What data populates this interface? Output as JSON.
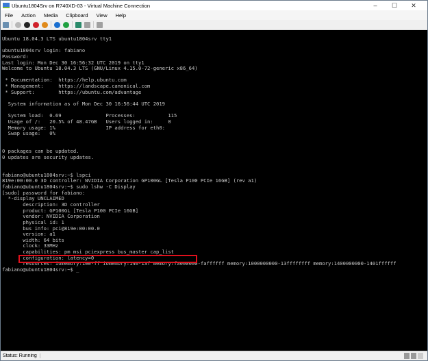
{
  "window": {
    "title": "Ubuntu1804Srv on R740XD-03 - Virtual Machine Connection"
  },
  "menu": [
    "File",
    "Action",
    "Media",
    "Clipboard",
    "View",
    "Help"
  ],
  "toolbar": [
    {
      "icon": "ctrl-alt-del-icon",
      "color": "#6a8fb0"
    },
    {
      "icon": "start-icon",
      "color": "#b8b8b8"
    },
    {
      "icon": "turn-off-icon",
      "color": "#222222"
    },
    {
      "icon": "shut-down-icon",
      "color": "#d0202a"
    },
    {
      "icon": "save-icon",
      "color": "#e08a1a"
    },
    {
      "icon": "pause-icon",
      "color": "#1a6fd0"
    },
    {
      "icon": "resume-icon",
      "color": "#20a040"
    },
    {
      "icon": "checkpoint-icon",
      "color": "#2a8a6a"
    },
    {
      "icon": "revert-icon",
      "color": "#a0a0a0"
    },
    {
      "icon": "enhanced-session-icon",
      "color": "#a0a0a0"
    }
  ],
  "console": {
    "lines": [
      "Ubuntu 18.04.3 LTS ubuntu1804srv tty1",
      "",
      "ubuntu1804srv login: fabiano",
      "Password:",
      "Last login: Mon Dec 30 16:56:32 UTC 2019 on tty1",
      "Welcome to Ubuntu 18.04.3 LTS (GNU/Linux 4.15.0-72-generic x86_64)",
      "",
      " * Documentation:  https://help.ubuntu.com",
      " * Management:     https://landscape.canonical.com",
      " * Support:        https://ubuntu.com/advantage",
      "",
      "  System information as of Mon Dec 30 16:56:44 UTC 2019",
      "",
      "  System load:  0.69               Processes:           115",
      "  Usage of /:   20.5% of 48.47GB   Users logged in:     0",
      "  Memory usage: 1%                 IP address for eth0:",
      "  Swap usage:   0%",
      "",
      "",
      "0 packages can be updated.",
      "0 updates are security updates.",
      "",
      "",
      "fabiano@ubuntu1804srv:~$ lspci",
      "819e:00:00.0 3D controller: NVIDIA Corporation GP100GL [Tesla P100 PCIe 16GB] (rev a1)",
      "fabiano@ubuntu1804srv:~$ sudo lshw -C Display",
      "[sudo] password for fabiano:",
      "  *-display UNCLAIMED",
      "       description: 3D controller",
      "       product: GP100GL [Tesla P100 PCIe 16GB]",
      "       vendor: NVIDIA Corporation",
      "       physical id: 1",
      "       bus info: pci@819e:00:00.0",
      "       version: a1",
      "       width: 64 bits",
      "       clock: 33MHz",
      "       capabilities: pm msi pciexpress bus_master cap_list",
      "       configuration: latency=0",
      "       resources: iomemory:100-ff iomemory:140-13f memory:fa000000-faffffff memory:1000000000-13ffffffff memory:1400000000-1401ffffff",
      "fabiano@ubuntu1804srv:~$ _"
    ]
  },
  "status": {
    "text": "Status: Running"
  }
}
